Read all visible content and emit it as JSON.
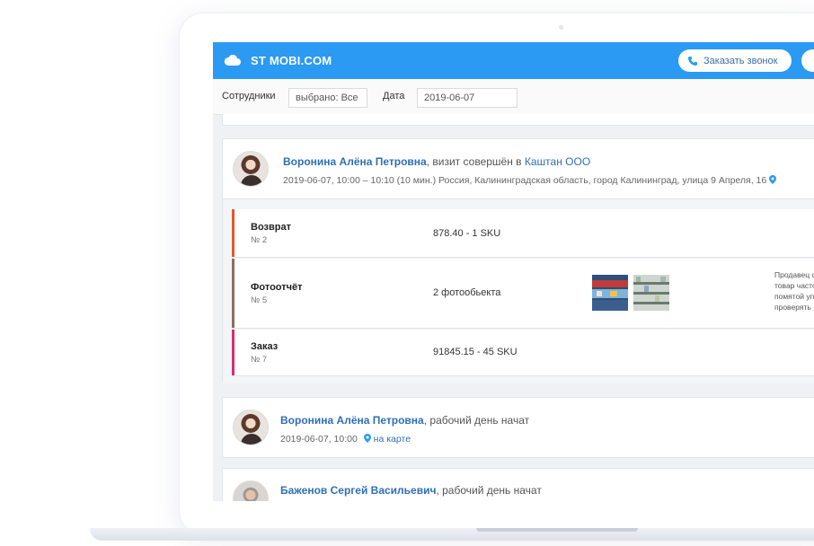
{
  "app": {
    "brand": "ST MOBI.COM",
    "call_button": "Заказать звонок",
    "accent": "#2b9af3"
  },
  "filters": {
    "employees_label": "Сотрудники",
    "employees_value": "выбрано: Все",
    "date_label": "Дата",
    "date_value": "2019-06-07"
  },
  "feed": [
    {
      "name": "Воронина Алёна Петровна",
      "event": ", визит совершён в ",
      "place": "Каштан ООО",
      "meta": "2019-06-07, 10:00 – 10:10 (10 мин.)  Россия, Калининградская область, город Калининград, улица 9 Апреля, 16",
      "documents": [
        {
          "title": "Возврат",
          "number": "№ 2",
          "value": "878.40 - 1 SKU",
          "color": "#e05a2b"
        },
        {
          "title": "Фотоотчёт",
          "number": "№ 5",
          "value": "2 фотообьекта",
          "color": "#8d6e63",
          "comment": [
            "Продавец с",
            "товар часто",
            "помятой уп",
            "проверять"
          ]
        },
        {
          "title": "Заказ",
          "number": "№ 7",
          "value": "91845.15 - 45 SKU",
          "color": "#d1306e"
        }
      ]
    },
    {
      "name": "Воронина Алёна Петровна",
      "event": ", рабочий день начат",
      "meta": "2019-06-07, 10:00",
      "map_link": "на карте"
    },
    {
      "name": "Баженов Сергей Васильевич",
      "event": ", рабочий день начат"
    }
  ]
}
